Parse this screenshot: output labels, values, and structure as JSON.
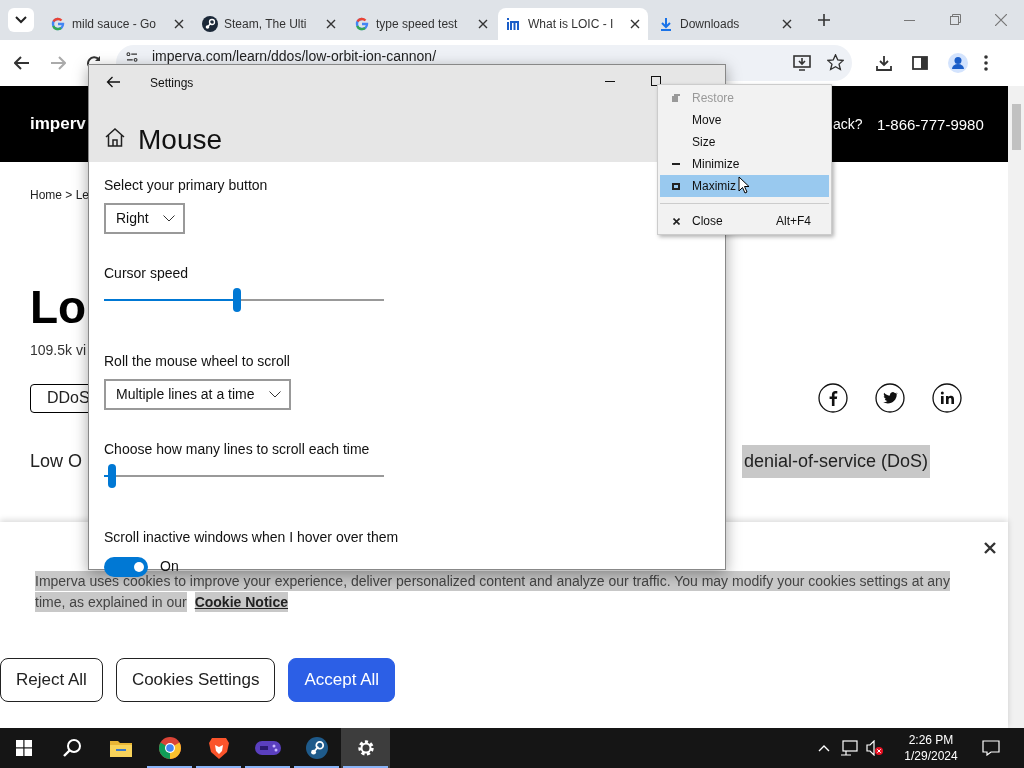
{
  "browser": {
    "tabs": [
      {
        "title": "mild sauce - Go",
        "kind": "google",
        "selected": false
      },
      {
        "title": "Steam, The Ulti",
        "kind": "steam",
        "selected": false
      },
      {
        "title": "type speed test",
        "kind": "google",
        "selected": false
      },
      {
        "title": "What is LOIC - I",
        "kind": "imperva",
        "selected": true
      },
      {
        "title": "Downloads",
        "kind": "download",
        "selected": false
      }
    ],
    "address": "imperva.com/learn/ddos/low-orbit-ion-cannon/"
  },
  "web_page": {
    "logo": "imperv",
    "header_question": "ack?",
    "phone": "1-866-777-9980",
    "breadcrumb": "Home > Le",
    "title": "Lo",
    "views": "109.5k vi",
    "tag_button": "DDoS",
    "lead_start": "Low O",
    "lead_highlight": "denial-of-service (DoS)"
  },
  "cookie_banner": {
    "text": "Imperva uses cookies to improve your experience, deliver personalized content and analyze our traffic. You may modify your cookies settings at any time, as explained in our",
    "link": "Cookie Notice",
    "buttons": [
      {
        "label": "Reject All",
        "kind": "outline"
      },
      {
        "label": "Cookies Settings",
        "kind": "outline"
      },
      {
        "label": "Accept All",
        "kind": "primary"
      }
    ]
  },
  "settings_window": {
    "title": "Settings",
    "heading": "Mouse",
    "settings": [
      {
        "kind": "dropdown",
        "label": "Select your primary button",
        "value": "Right"
      },
      {
        "kind": "slider",
        "label": "Cursor speed",
        "level": 0.475
      },
      {
        "kind": "dropdown",
        "label": "Roll the mouse wheel to scroll",
        "value": "Multiple lines at a time"
      },
      {
        "kind": "slider",
        "label": "Choose how many lines to scroll each time",
        "level": 0.03
      },
      {
        "kind": "toggle",
        "label": "Scroll inactive windows when I hover over them",
        "on": true,
        "state_text": "On"
      }
    ]
  },
  "context_menu": {
    "items": [
      {
        "label": "Restore",
        "kind": "restore",
        "disabled": true,
        "selected": false
      },
      {
        "label": "Move",
        "kind": "plain",
        "disabled": false,
        "selected": false
      },
      {
        "label": "Size",
        "kind": "plain",
        "disabled": false,
        "selected": false
      },
      {
        "label": "Minimize",
        "kind": "minimize",
        "disabled": false,
        "selected": false
      },
      {
        "label": "Maximiz",
        "kind": "maximize",
        "disabled": false,
        "selected": true
      },
      {
        "label": "Close",
        "kind": "close",
        "shortcut": "Alt+F4",
        "disabled": false,
        "selected": false
      }
    ]
  },
  "taskbar": {
    "apps": [
      {
        "kind": "folder",
        "running": false,
        "active": false
      },
      {
        "kind": "chrome",
        "running": true,
        "active": false
      },
      {
        "kind": "brave",
        "running": true,
        "active": false
      },
      {
        "kind": "gamepad",
        "running": true,
        "active": false
      },
      {
        "kind": "steam",
        "running": true,
        "active": false
      },
      {
        "kind": "gear",
        "running": true,
        "active": true
      }
    ],
    "time": "2:26 PM",
    "date": "1/29/2024"
  }
}
